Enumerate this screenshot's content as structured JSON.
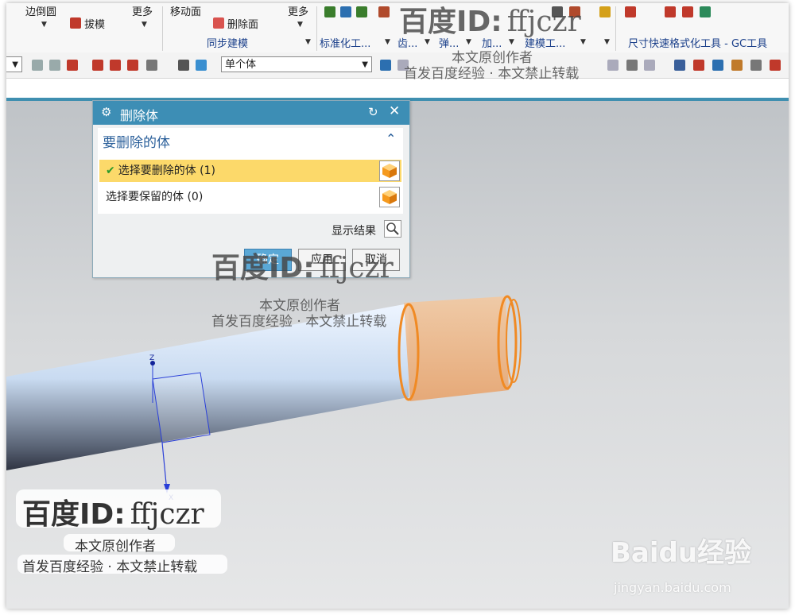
{
  "ribbon": {
    "items": {
      "edge_blend": "边倒圆",
      "draft": "拔模",
      "more1": "更多",
      "move_face": "移动面",
      "delete_face": "删除面",
      "more2": "更多"
    },
    "groups": {
      "sync_modeling": "同步建模",
      "standardize": "标准化工...",
      "gear": "齿...",
      "spring": "弹...",
      "machining": "加...",
      "modeling_tools": "建模工...",
      "dimension_tool": "尺寸快速格式化工具 - GC工具"
    }
  },
  "toolbar": {
    "selection_scope": "单个体"
  },
  "dialog": {
    "title": "删除体",
    "group_title": "要删除的体",
    "rows": [
      {
        "label": "选择要删除的体 (1)",
        "selected": true
      },
      {
        "label": "选择要保留的体 (0)",
        "selected": false
      }
    ],
    "show_result": "显示结果",
    "buttons": {
      "ok": "确定",
      "apply": "应用",
      "cancel": "取消"
    }
  },
  "watermark": {
    "brand": "百度ID:",
    "id": "ffjczr",
    "line1": "本文原创作者",
    "line2": "首发百度经验 · 本文禁止转载",
    "site_logo": "Baidu经验",
    "site_url": "jingyan.baidu.com"
  },
  "colors": {
    "title_bar": "#3d8eb5",
    "selected_row": "#fcd96a",
    "cube": "#f59a1e",
    "tube": "#cfe0f5",
    "sleeve": "#f2b27a"
  }
}
